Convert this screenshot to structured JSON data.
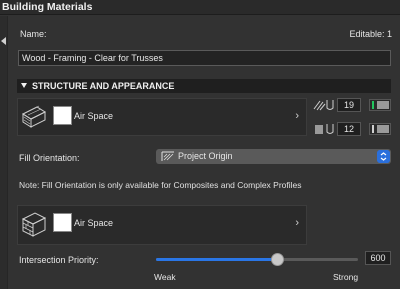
{
  "title": "Building Materials",
  "name_label": "Name:",
  "editable_label": "Editable: 1",
  "name_value": "Wood - Framing - Clear for Trusses",
  "section_header": "STRUCTURE AND APPEARANCE",
  "surface_top": {
    "material": "Air Space",
    "swatch_color": "#ffffff",
    "pen_fore": "19",
    "pen_fore_color": "#22c55e",
    "pen_back": "12",
    "pen_back_color": "#d0d0d0"
  },
  "fill_orientation": {
    "label": "Fill Orientation:",
    "value": "Project Origin"
  },
  "note": "Note: Fill Orientation is only available for Composites and Complex Profiles",
  "surface_cut": {
    "material": "Air Space",
    "swatch_color": "#ffffff"
  },
  "intersection_priority": {
    "label": "Intersection Priority:",
    "value": "600",
    "level_fraction": 0.6,
    "min_label": "Weak",
    "max_label": "Strong",
    "accent": "#2a76e6"
  }
}
